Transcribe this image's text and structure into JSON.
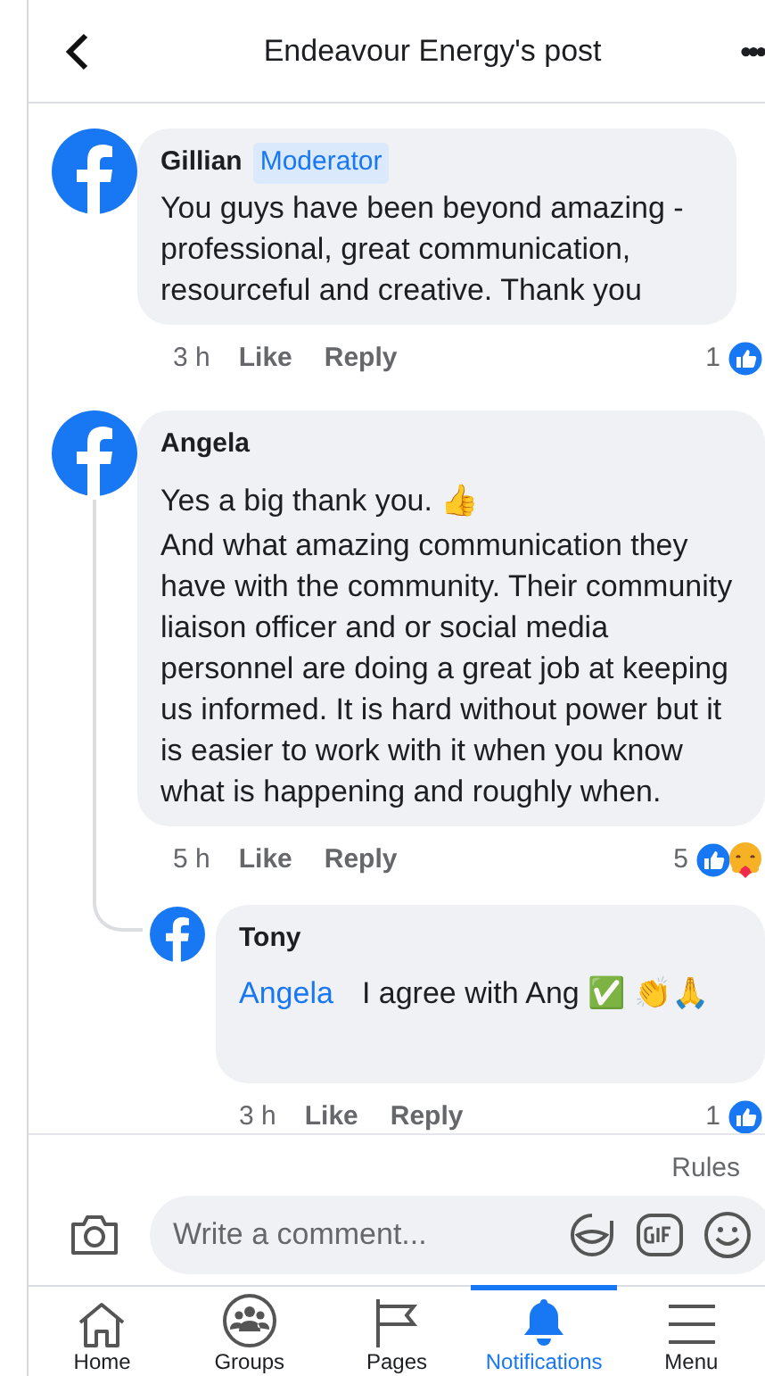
{
  "header": {
    "title": "Endeavour Energy's post",
    "more": "•••"
  },
  "comments": [
    {
      "author": "Gillian",
      "badge": "Moderator",
      "text": "You guys have been beyond amazing - professional, great communication, resourceful and creative. Thank you",
      "time": "3 h",
      "like": "Like",
      "reply": "Reply",
      "reaction_count": "1",
      "reactions": [
        {
          "kind": "like"
        }
      ]
    },
    {
      "author": "Angela",
      "paragraphs": [
        "Yes a big thank you. 👍",
        "And what amazing communication they have with the community. Their community liaison officer and or social media personnel are doing a great job at keeping us informed. It is hard without power but it is easier to work with it when you know what is happening and roughly when."
      ],
      "time": "5 h",
      "like": "Like",
      "reply": "Reply",
      "reaction_count": "5",
      "reactions": [
        {
          "kind": "like"
        },
        {
          "kind": "care"
        }
      ],
      "replies": [
        {
          "author": "Tony",
          "mention": "Angela",
          "text": "I agree with Ang ✅ 👏🙏",
          "time": "3 h",
          "like": "Like",
          "reply": "Reply",
          "reaction_count": "1",
          "reactions": [
            {
              "kind": "like"
            }
          ]
        }
      ]
    }
  ],
  "rules": "Rules",
  "composer": {
    "placeholder": "Write a comment..."
  },
  "nav": [
    {
      "kind": "home",
      "label": "Home",
      "selected": false
    },
    {
      "kind": "groups",
      "label": "Groups",
      "selected": false
    },
    {
      "kind": "pages",
      "label": "Pages",
      "selected": false
    },
    {
      "kind": "notifications",
      "label": "Notifications",
      "selected": true
    },
    {
      "kind": "menu",
      "label": "Menu",
      "selected": false
    }
  ]
}
